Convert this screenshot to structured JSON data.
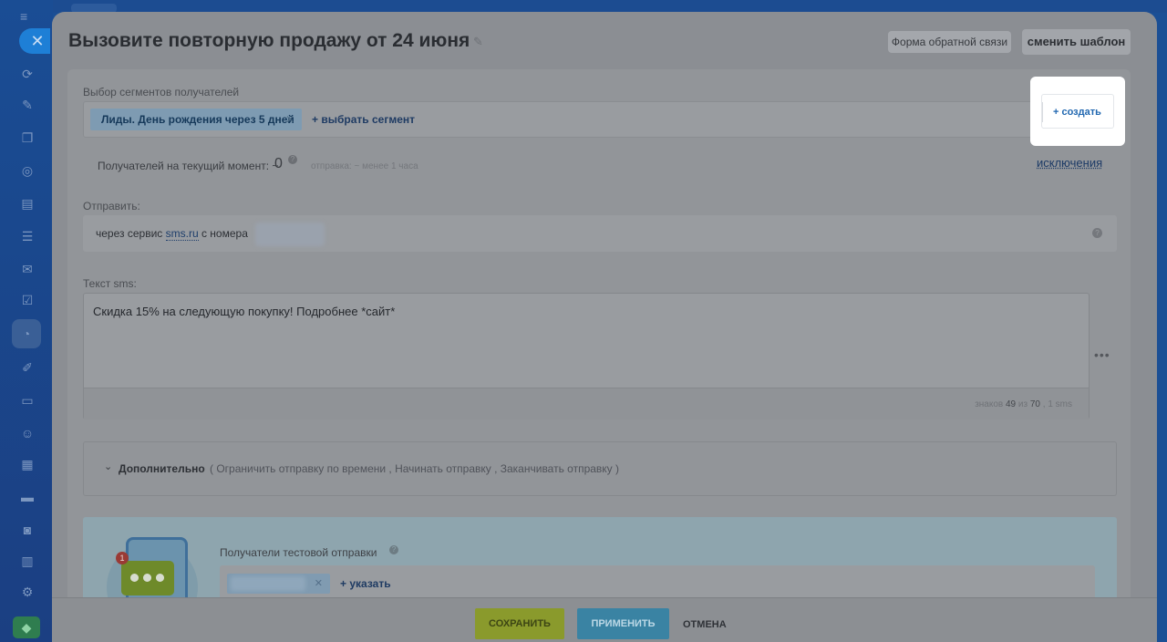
{
  "panel": {
    "title": "Вызовите повторную продажу от 24 июня",
    "feedback_label": "Форма обратной связи",
    "change_template_label": "сменить шаблон"
  },
  "segments": {
    "label": "Выбор сегментов получателей",
    "chip_label": "Лиды. День рождения через 5 дней",
    "add_label": "+ выбрать сегмент",
    "create_label": "+ создать"
  },
  "recipients": {
    "label": "Получателей на текущий момент: ~",
    "count": "0",
    "send_time": "отправка: ~ менее 1 часа",
    "exclusions_label": "исключения"
  },
  "send": {
    "label": "Отправить:",
    "prefix": "через сервис",
    "service": "sms.ru",
    "suffix": "с номера"
  },
  "sms": {
    "label": "Текст sms:",
    "text": "Скидка 15% на следующую покупку! Подробнее *сайт*",
    "counter_prefix": "знаков",
    "chars": "49",
    "counter_mid": "из",
    "max": "70",
    "counter_sms": ", 1 sms"
  },
  "additional": {
    "title": "Дополнительно",
    "options": "( Ограничить отправку по времени ,  Начинать отправку ,  Заканчивать отправку )"
  },
  "test": {
    "label": "Получатели тестовой отправки",
    "add_label": "+ указать",
    "badge": "1"
  },
  "buttons": {
    "save": "СОХРАНИТЬ",
    "apply": "ПРИМЕНИТЬ",
    "cancel": "ОТМЕНА"
  }
}
